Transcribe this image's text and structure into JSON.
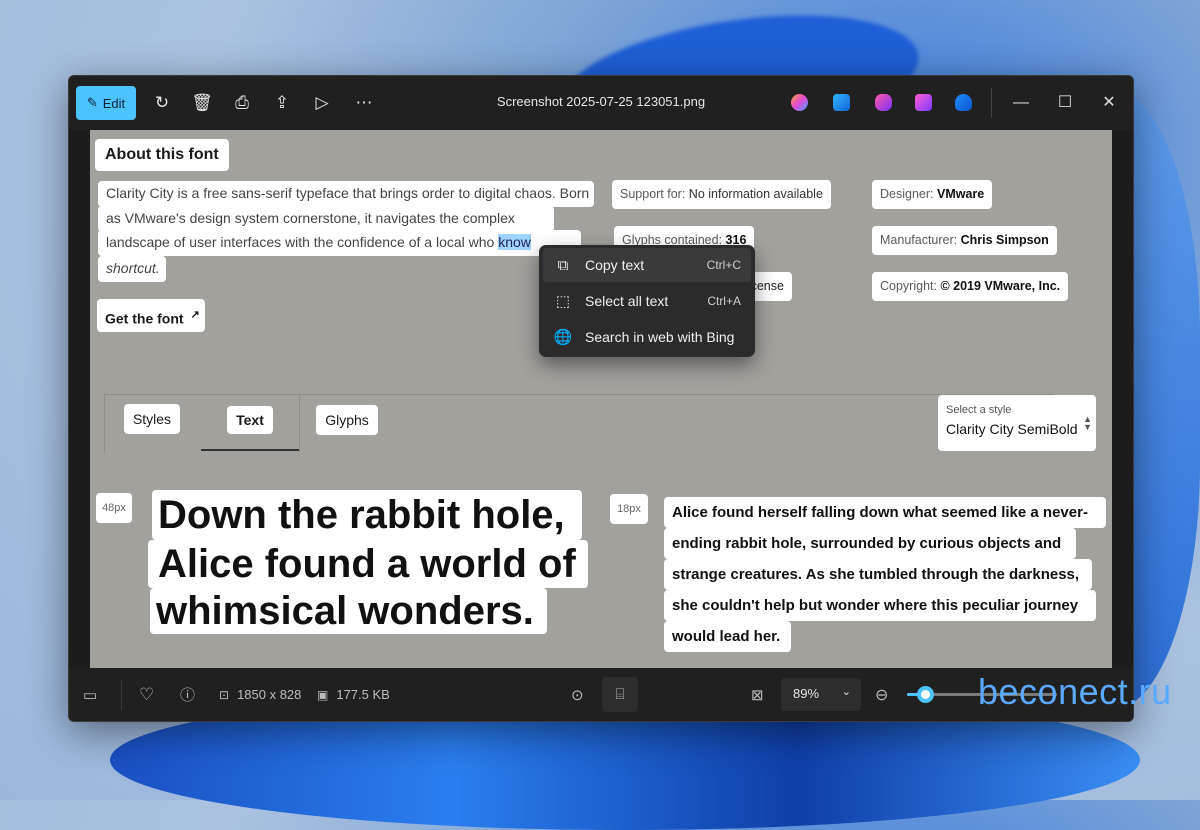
{
  "window": {
    "title": "Screenshot 2025-07-25 123051.png",
    "edit_label": "Edit"
  },
  "font_info": {
    "heading": "About this font",
    "description_lines": [
      "Clarity City is a free sans-serif typeface that brings order to digital chaos. Born",
      "as VMware's design system cornerstone, it navigates the complex urban",
      "landscape of user interfaces with the confidence of a local who ",
      "shortcut."
    ],
    "highlighted_word": "know",
    "get_font_label": "Get the font",
    "support_label": "Support for: ",
    "support_value": "No information available",
    "glyphs_label": "Glyphs contained: ",
    "glyphs_value": "316",
    "license_value": "ont License",
    "designer_label": "Designer: ",
    "designer_value": "VMware",
    "manufacturer_label": "Manufacturer: ",
    "manufacturer_value": "Chris Simpson",
    "copyright_label": "Copyright: ",
    "copyright_value": "© 2019 VMware, Inc."
  },
  "context_menu": {
    "items": [
      {
        "label": "Copy text",
        "shortcut": "Ctrl+C",
        "icon": "copy-icon"
      },
      {
        "label": "Select all text",
        "shortcut": "Ctrl+A",
        "icon": "select-all-icon"
      },
      {
        "label": "Search in web with Bing",
        "shortcut": "",
        "icon": "globe-icon"
      }
    ]
  },
  "tabs": [
    {
      "label": "Styles"
    },
    {
      "label": "Text",
      "active": true
    },
    {
      "label": "Glyphs"
    }
  ],
  "style_select": {
    "caption": "Select a style",
    "value": "Clarity City SemiBold"
  },
  "preview": {
    "large_size": "48px",
    "large_lines": [
      "Down the rabbit hole,",
      "Alice found a world of",
      "whimsical wonders."
    ],
    "small_size": "18px",
    "small_lines": [
      "Alice found herself falling down what seemed like a never-",
      "ending rabbit hole, surrounded by curious objects and",
      "strange creatures. As she tumbled through the darkness,",
      "she couldn't help but wonder where this peculiar journey",
      "would lead her."
    ]
  },
  "bottom_bar": {
    "dimensions": "1850 x 828",
    "file_size": "177.5 KB",
    "zoom": "89%",
    "zoom_level": 0.12
  },
  "watermark": "beconect.ru",
  "colors": {
    "accent": "#4cc2ff",
    "titlebar": "#202020",
    "canvas": "#a3a19c"
  }
}
